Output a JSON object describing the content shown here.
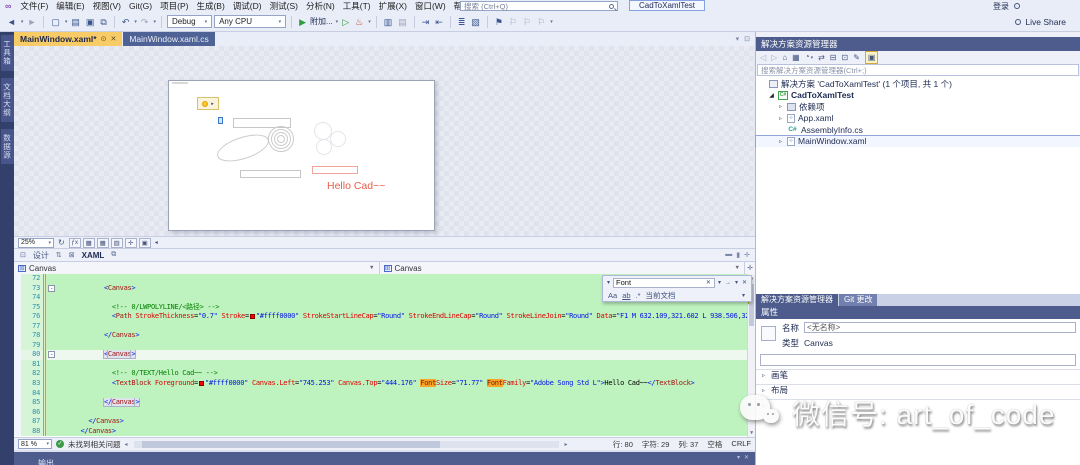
{
  "window": {
    "menus": [
      "文件(F)",
      "编辑(E)",
      "视图(V)",
      "Git(G)",
      "项目(P)",
      "生成(B)",
      "调试(D)",
      "测试(S)",
      "分析(N)",
      "工具(T)",
      "扩展(X)",
      "窗口(W)",
      "帮助(H)"
    ],
    "search_placeholder": "搜索 (Ctrl+Q)",
    "title": "CadToXamlTest",
    "sign_in": "登录",
    "live_share": "Live Share"
  },
  "toolbar": {
    "debug_config": "Debug",
    "platform": "Any CPU",
    "attach_label": "附加..."
  },
  "side_tabs": [
    "工具箱",
    "文档大纲",
    "数据源"
  ],
  "doc_tabs": {
    "tab1": "MainWindow.xaml*",
    "tab2": "MainWindow.xaml.cs"
  },
  "designer": {
    "zoom": "25%",
    "hello_text": "Hello Cad~~"
  },
  "view_switch": {
    "design_label": "设计",
    "xaml_label": "XAML"
  },
  "breadcrumb": {
    "left": "Canvas",
    "right": "Canvas"
  },
  "find": {
    "query": "Font",
    "match_case": "Aa",
    "word": "ab",
    "regex": ".*",
    "scope": "当前文档"
  },
  "code": {
    "lines": [
      {
        "n": 72,
        "seg": []
      },
      {
        "n": 73,
        "fold": true,
        "seg": [
          [
            "t",
            "            "
          ],
          [
            "d",
            "<"
          ],
          [
            "e",
            "Canvas"
          ],
          [
            "d",
            ">"
          ]
        ]
      },
      {
        "n": 74,
        "seg": []
      },
      {
        "n": 75,
        "seg": [
          [
            "t",
            "              "
          ],
          [
            "c",
            "<!-- 0/LWPOLYLINE/<路径> -->"
          ]
        ]
      },
      {
        "n": 76,
        "seg": [
          [
            "t",
            "              "
          ],
          [
            "d",
            "<"
          ],
          [
            "e",
            "Path"
          ],
          [
            "t",
            " "
          ],
          [
            "a",
            "StrokeThickness"
          ],
          [
            "o",
            "="
          ],
          [
            "v",
            "\"0.7\""
          ],
          [
            "t",
            " "
          ],
          [
            "a",
            "Stroke"
          ],
          [
            "o",
            "="
          ],
          [
            "sw",
            ""
          ],
          [
            "v",
            "\"#ffff0000\""
          ],
          [
            "t",
            " "
          ],
          [
            "a",
            "StrokeStartLineCap"
          ],
          [
            "o",
            "="
          ],
          [
            "v",
            "\"Round\""
          ],
          [
            "t",
            " "
          ],
          [
            "a",
            "StrokeEndLineCap"
          ],
          [
            "o",
            "="
          ],
          [
            "v",
            "\"Round\""
          ],
          [
            "t",
            " "
          ],
          [
            "a",
            "StrokeLineJoin"
          ],
          [
            "o",
            "="
          ],
          [
            "v",
            "\"Round\""
          ],
          [
            "t",
            " "
          ],
          [
            "a",
            "Data"
          ],
          [
            "o",
            "="
          ],
          [
            "v",
            "\"F1 M 632.109,321.602 L 938.506,321.602 L 938.506,37"
          ]
        ]
      },
      {
        "n": 77,
        "seg": []
      },
      {
        "n": 78,
        "seg": [
          [
            "t",
            "            "
          ],
          [
            "d",
            "</"
          ],
          [
            "e",
            "Canvas"
          ],
          [
            "d",
            ">"
          ]
        ]
      },
      {
        "n": 79,
        "seg": []
      },
      {
        "n": 80,
        "cur": true,
        "fold": true,
        "seg": [
          [
            "t",
            "            "
          ],
          [
            "bx d",
            "<"
          ],
          [
            "bx e",
            "Canvas"
          ],
          [
            "bx d",
            ">"
          ]
        ]
      },
      {
        "n": 81,
        "seg": []
      },
      {
        "n": 82,
        "seg": [
          [
            "t",
            "              "
          ],
          [
            "c",
            "<!-- 0/TEXT/Hello Cad~~ -->"
          ]
        ]
      },
      {
        "n": 83,
        "seg": [
          [
            "t",
            "              "
          ],
          [
            "d",
            "<"
          ],
          [
            "e",
            "TextBlock"
          ],
          [
            "t",
            " "
          ],
          [
            "a",
            "Foreground"
          ],
          [
            "o",
            "="
          ],
          [
            "sw",
            ""
          ],
          [
            "v",
            "\"#ffff0000\""
          ],
          [
            "t",
            " "
          ],
          [
            "a",
            "Canvas.Left"
          ],
          [
            "o",
            "="
          ],
          [
            "v",
            "\"745.253\""
          ],
          [
            "t",
            " "
          ],
          [
            "a",
            "Canvas.Top"
          ],
          [
            "o",
            "="
          ],
          [
            "v",
            "\"444.176\""
          ],
          [
            "t",
            " "
          ],
          [
            "hl",
            "Font"
          ],
          [
            "a",
            "Size"
          ],
          [
            "o",
            "="
          ],
          [
            "v",
            "\"71.77\""
          ],
          [
            "t",
            " "
          ],
          [
            "hl",
            "Font"
          ],
          [
            "a",
            "Family"
          ],
          [
            "o",
            "="
          ],
          [
            "v",
            "\"Adobe Song Std L\""
          ],
          [
            "d",
            ">"
          ],
          [
            "t",
            "Hello Cad~~"
          ],
          [
            "d",
            "</"
          ],
          [
            "e",
            "TextBlock"
          ],
          [
            "d",
            ">"
          ]
        ]
      },
      {
        "n": 84,
        "seg": []
      },
      {
        "n": 85,
        "seg": [
          [
            "t",
            "            "
          ],
          [
            "bx d",
            "</"
          ],
          [
            "bx e",
            "Canvas"
          ],
          [
            "bx d",
            ">"
          ]
        ]
      },
      {
        "n": 86,
        "seg": []
      },
      {
        "n": 87,
        "seg": [
          [
            "t",
            "        "
          ],
          [
            "d",
            "</"
          ],
          [
            "e",
            "Canvas"
          ],
          [
            "d",
            ">"
          ]
        ]
      },
      {
        "n": 88,
        "seg": [
          [
            "t",
            "      "
          ],
          [
            "d",
            "</"
          ],
          [
            "e",
            "Canvas"
          ],
          [
            "d",
            ">"
          ]
        ]
      }
    ]
  },
  "editor_status": {
    "zoom": "81 %",
    "message": "未找到相关问题",
    "line": "行: 80",
    "chars": "字符: 29",
    "col": "列: 37",
    "space": "空格",
    "eol": "CRLF"
  },
  "output_panel": {
    "title": "输出"
  },
  "solution_explorer": {
    "title": "解决方案资源管理器",
    "search_placeholder": "搜索解决方案资源管理器(Ctrl+;)",
    "tree": [
      {
        "icon": "solution",
        "arrow": "",
        "indent": 0,
        "label": "解决方案 'CadToXamlTest' (1 个项目, 共 1 个)"
      },
      {
        "icon": "csproj",
        "arrow": "open",
        "indent": 1,
        "label": "CadToXamlTest",
        "bold": true
      },
      {
        "icon": "deps",
        "arrow": "closed",
        "indent": 2,
        "label": "依赖项"
      },
      {
        "icon": "xaml",
        "arrow": "closed",
        "indent": 2,
        "label": "App.xaml"
      },
      {
        "icon": "cs",
        "arrow": "",
        "indent": 2,
        "label": "AssemblyInfo.cs"
      },
      {
        "icon": "xaml",
        "arrow": "closed",
        "indent": 2,
        "label": "MainWindow.xaml",
        "selected": true
      }
    ],
    "tabs": {
      "tab1": "解决方案资源管理器",
      "tab2": "Git 更改"
    }
  },
  "properties": {
    "title": "属性",
    "name_label": "名称",
    "name_value": "<无名称>",
    "type_label": "类型",
    "type_value": "Canvas",
    "sections": [
      "画笔",
      "布局"
    ]
  },
  "watermark": {
    "text": "微信号: art_of_code"
  }
}
